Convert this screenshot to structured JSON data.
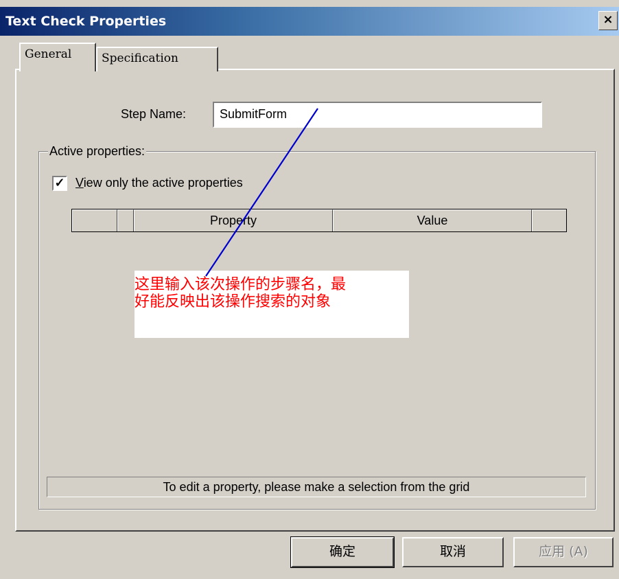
{
  "window": {
    "title": "Text Check Properties",
    "close_glyph": "x"
  },
  "tabs": [
    {
      "label": "General",
      "active": true
    },
    {
      "label": "Specification",
      "active": false
    }
  ],
  "general": {
    "step_name_label": "Step Name:",
    "step_name_value": "SubmitForm",
    "active_properties_legend": "Active properties:",
    "view_only_checkbox": {
      "checked": true,
      "label": "View only the active properties",
      "mnemonic": "V"
    },
    "grid": {
      "columns": [
        "",
        "",
        "Property",
        "Value",
        ""
      ]
    },
    "status_text": "To edit a property, please make a selection from the grid"
  },
  "annotation": {
    "lines": [
      "这里输入该次操作的步骤名，最",
      "好能反映出该操作搜索的对象"
    ],
    "text_color": "#ff0000",
    "arrow_color": "#0000cc"
  },
  "buttons": {
    "ok": "确定",
    "cancel": "取消",
    "apply": "应用 (A)"
  },
  "icons": {
    "close": "close-icon",
    "checkmark": "checkmark-icon"
  }
}
